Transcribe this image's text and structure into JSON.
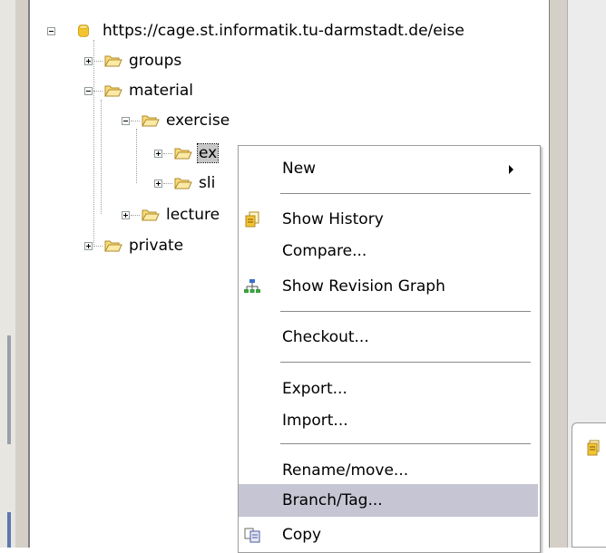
{
  "tree": {
    "root_url": "https://cage.st.informatik.tu-darmstadt.de/eise",
    "groups": "groups",
    "material": "material",
    "exercise": "exercise",
    "ex_child": "ex",
    "sli_child": "sli",
    "lecture": "lecture",
    "private": "private"
  },
  "menu": {
    "new": "New",
    "show_history": "Show History",
    "compare": "Compare...",
    "show_revision_graph": "Show Revision Graph",
    "checkout": "Checkout...",
    "export": "Export...",
    "import": "Import...",
    "rename_move": "Rename/move...",
    "branch_tag": "Branch/Tag...",
    "copy": "Copy"
  },
  "colors": {
    "menu_highlight": "#c5c5d3",
    "window_bg": "#d4d0c8",
    "folder": "#f1c24a"
  },
  "icons": {
    "root": "repository-icon",
    "folder": "folder-icon",
    "history": "history-icon",
    "revision_graph": "revision-graph-icon",
    "copy": "copy-icon",
    "submenu": "submenu-arrow-icon"
  }
}
